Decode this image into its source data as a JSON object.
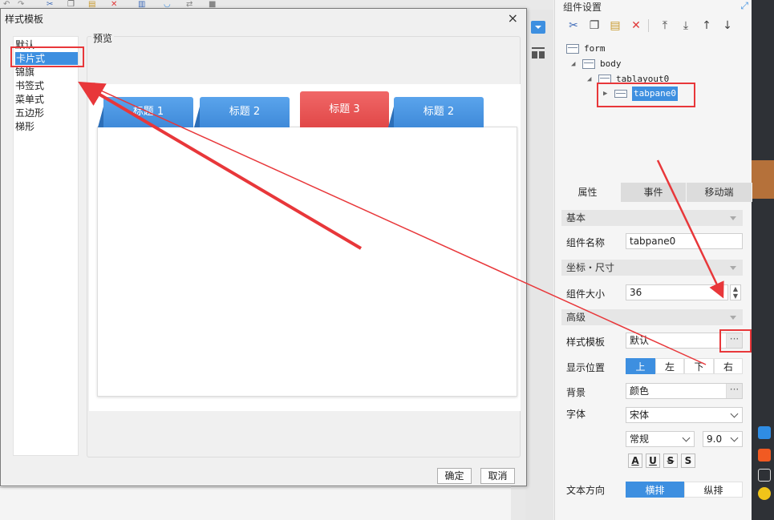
{
  "modal": {
    "title": "样式模板",
    "close_glyph": "×",
    "style_list": [
      "默认",
      "卡片式",
      "锦旗",
      "书签式",
      "菜单式",
      "五边形",
      "梯形"
    ],
    "selected_index": 1,
    "preview_label": "预览",
    "preview_tabs": [
      "标题 1",
      "标题 2",
      "标题 3",
      "标题 2"
    ],
    "active_preview_tab": 2,
    "ok_label": "确定",
    "cancel_label": "取消"
  },
  "panel": {
    "title": "组件设置",
    "toolbar_icons": [
      "cut-icon",
      "copy-icon",
      "paste-icon",
      "delete-icon",
      "move-top-icon",
      "move-bottom-icon",
      "move-up-icon",
      "move-down-icon"
    ],
    "tree": {
      "form": "form",
      "body": "body",
      "tablayout": "tablayout0",
      "tabpane": "tabpane0"
    },
    "tabs": [
      "属性",
      "事件",
      "移动端"
    ],
    "sections": {
      "basic": "基本",
      "coords": "坐标・尺寸",
      "advanced": "高级"
    },
    "labels": {
      "name": "组件名称",
      "size": "组件大小",
      "style_template": "样式模板",
      "position": "显示位置",
      "background": "背景",
      "font": "字体",
      "text_direction": "文本方向"
    },
    "values": {
      "name": "tabpane0",
      "size": "36",
      "style_template": "默认",
      "background": "颜色",
      "font_family": "宋体",
      "font_style": "常规",
      "font_size": "9.0"
    },
    "position_options": [
      "上",
      "左",
      "下",
      "右"
    ],
    "position_selected": 0,
    "direction_options": [
      "横排",
      "纵排"
    ],
    "direction_selected": 0,
    "font_buttons": [
      "A",
      "U",
      "S",
      "S"
    ],
    "dots": "···"
  },
  "colors": {
    "accent": "#3d8fe0",
    "annotation": "#e8373a",
    "tab_blue": "#4a97e4",
    "tab_red": "#e85656"
  }
}
